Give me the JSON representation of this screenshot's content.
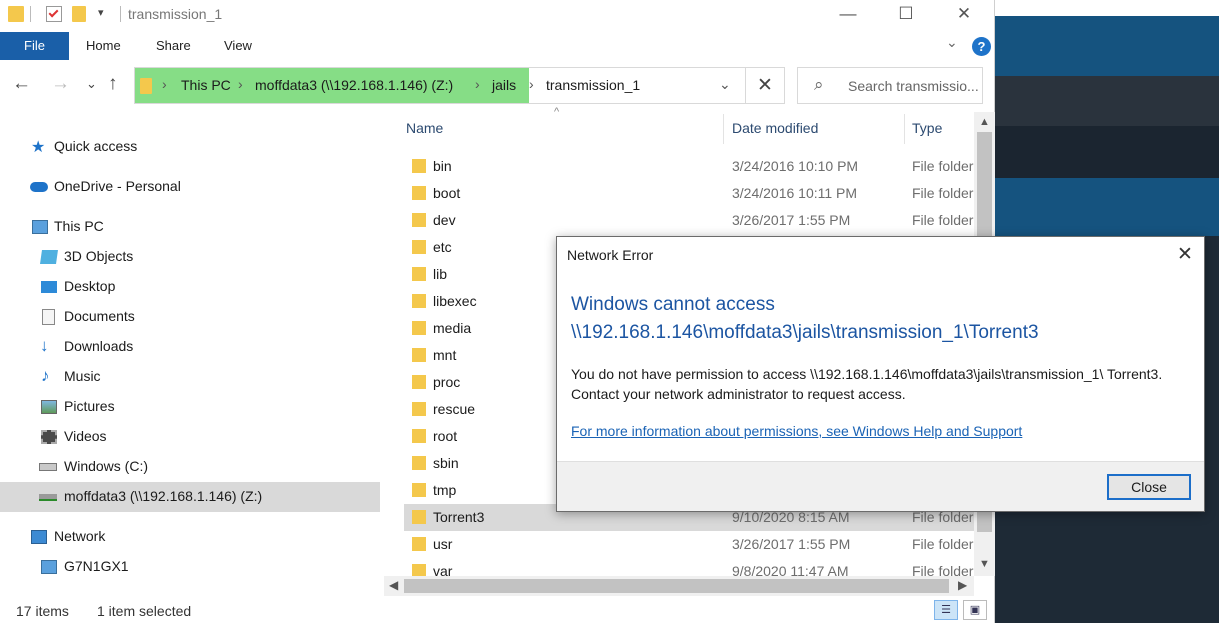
{
  "window": {
    "title": "transmission_1",
    "minimize_label": "—",
    "maximize_label": "☐",
    "close_label": "✕"
  },
  "ribbon": {
    "tabs": [
      "File",
      "Home",
      "Share",
      "View"
    ],
    "help_label": "?",
    "expand_label": "⌄"
  },
  "nav": {
    "back": "←",
    "forward": "→",
    "recent": "⌄",
    "up": "↑"
  },
  "address": {
    "segments": [
      "This PC",
      "moffdata3 (\\\\192.168.1.146) (Z:)",
      "jails",
      "transmission_1"
    ],
    "separator": "›",
    "dropdown": "⌄",
    "clear": "✕"
  },
  "search": {
    "placeholder": "Search transmissio...",
    "icon": "⌕"
  },
  "navpane": {
    "items": [
      {
        "label": "Quick access",
        "icon": "star-icon"
      },
      {
        "label": "OneDrive - Personal",
        "icon": "cloud-icon"
      },
      {
        "label": "This PC",
        "icon": "computer-icon"
      },
      {
        "label": "3D Objects",
        "icon": "cube-icon"
      },
      {
        "label": "Desktop",
        "icon": "desktop-icon"
      },
      {
        "label": "Documents",
        "icon": "documents-icon"
      },
      {
        "label": "Downloads",
        "icon": "download-icon"
      },
      {
        "label": "Music",
        "icon": "music-icon"
      },
      {
        "label": "Pictures",
        "icon": "pictures-icon"
      },
      {
        "label": "Videos",
        "icon": "videos-icon"
      },
      {
        "label": "Windows (C:)",
        "icon": "drive-icon"
      },
      {
        "label": "moffdata3 (\\\\192.168.1.146) (Z:)",
        "icon": "network-drive-icon"
      },
      {
        "label": "Network",
        "icon": "network-icon"
      },
      {
        "label": "G7N1GX1",
        "icon": "computer-icon"
      }
    ]
  },
  "filelist": {
    "columns": {
      "name": "Name",
      "date": "Date modified",
      "type": "Type"
    },
    "sort_indicator": "^",
    "rows": [
      {
        "name": "bin",
        "date": "3/24/2016 10:10 PM",
        "type": "File folder"
      },
      {
        "name": "boot",
        "date": "3/24/2016 10:11 PM",
        "type": "File folder"
      },
      {
        "name": "dev",
        "date": "3/26/2017 1:55 PM",
        "type": "File folder"
      },
      {
        "name": "etc",
        "date": "",
        "type": ""
      },
      {
        "name": "lib",
        "date": "",
        "type": ""
      },
      {
        "name": "libexec",
        "date": "",
        "type": ""
      },
      {
        "name": "media",
        "date": "",
        "type": ""
      },
      {
        "name": "mnt",
        "date": "",
        "type": ""
      },
      {
        "name": "proc",
        "date": "",
        "type": ""
      },
      {
        "name": "rescue",
        "date": "",
        "type": ""
      },
      {
        "name": "root",
        "date": "",
        "type": ""
      },
      {
        "name": "sbin",
        "date": "",
        "type": ""
      },
      {
        "name": "tmp",
        "date": "",
        "type": ""
      },
      {
        "name": "Torrent3",
        "date": "9/10/2020 8:15 AM",
        "type": "File folder"
      },
      {
        "name": "usr",
        "date": "3/26/2017 1:55 PM",
        "type": "File folder"
      },
      {
        "name": "var",
        "date": "9/8/2020 11:47 AM",
        "type": "File folder"
      }
    ]
  },
  "status": {
    "item_count": "17 items",
    "selection": "1 item selected"
  },
  "dialog": {
    "title": "Network Error",
    "heading": "Windows cannot access \\\\192.168.1.146\\moffdata3\\jails\\transmission_1\\Torrent3",
    "body": "You do not have permission to access \\\\192.168.1.146\\moffdata3\\jails\\transmission_1\\ Torrent3. Contact your network administrator to request access.",
    "link": "For more information about permissions, see Windows Help and Support",
    "close_button": "Close",
    "close_x": "✕"
  },
  "colors": {
    "accent": "#1a5fa8",
    "address_highlight": "#86dd86",
    "link": "#1a63b5",
    "heading": "#1c55a2",
    "folder": "#f4c84c"
  }
}
